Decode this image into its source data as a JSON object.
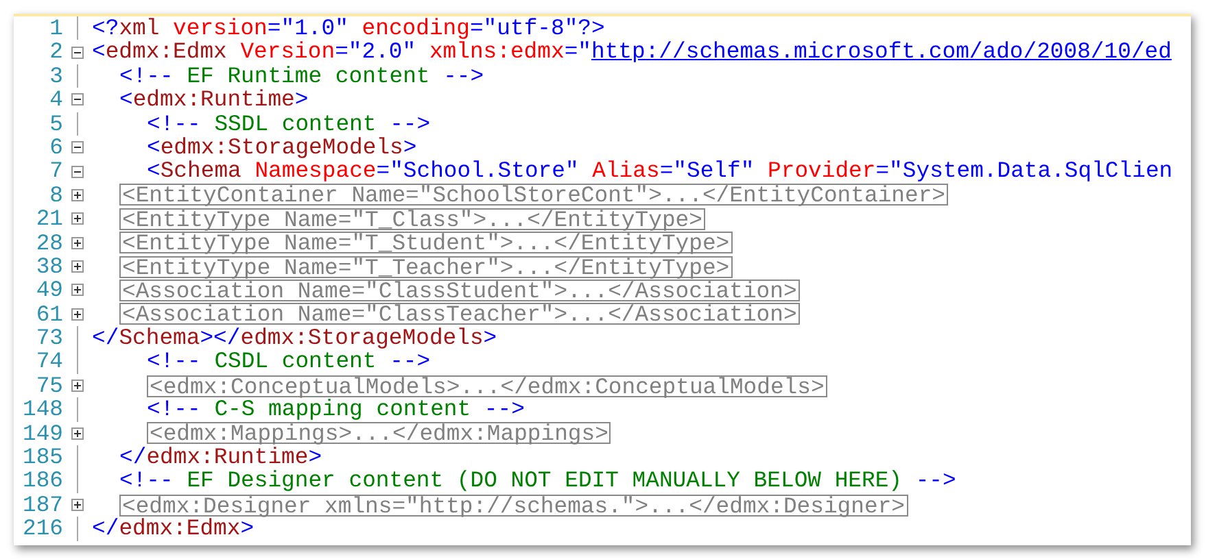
{
  "editor": {
    "lines": [
      {
        "number": "1",
        "kind": "root",
        "segments": [
          {
            "kind": "code",
            "tokens": [
              {
                "kind": "delim",
                "text": "<?"
              },
              {
                "kind": "tag",
                "text": "xml"
              },
              {
                "kind": "attr",
                "text": " version"
              },
              {
                "kind": "value",
                "text": "=\"1.0\""
              },
              {
                "kind": "attr",
                "text": " encoding"
              },
              {
                "kind": "value",
                "text": "=\"utf-8\""
              },
              {
                "kind": "delim",
                "text": "?>"
              }
            ]
          }
        ]
      },
      {
        "number": "2",
        "kind": "root",
        "expanded": true,
        "segments": [
          {
            "kind": "code",
            "tokens": [
              {
                "kind": "delim",
                "text": "<"
              },
              {
                "kind": "tag",
                "text": "edmx:Edmx"
              },
              {
                "kind": "attr",
                "text": " Version"
              },
              {
                "kind": "value",
                "text": "=\"2.0\""
              },
              {
                "kind": "attr",
                "text": " xmlns:edmx"
              },
              {
                "kind": "value",
                "text": "=\""
              }
            ]
          },
          {
            "kind": "link",
            "text": "http://schemas.microsoft.com/ado/2008/10/ed"
          }
        ]
      },
      {
        "number": "3",
        "kind": "child",
        "segments": [
          {
            "kind": "code",
            "tokens": [
              {
                "kind": "delim",
                "text": "<!--"
              },
              {
                "kind": "comment",
                "text": " EF Runtime content "
              },
              {
                "kind": "delim",
                "text": "-->"
              }
            ]
          }
        ]
      },
      {
        "number": "4",
        "kind": "child",
        "expanded": true,
        "segments": [
          {
            "kind": "code",
            "tokens": [
              {
                "kind": "delim",
                "text": "<"
              },
              {
                "kind": "tag",
                "text": "edmx:Runtime"
              },
              {
                "kind": "delim",
                "text": ">"
              }
            ]
          }
        ]
      },
      {
        "number": "5",
        "kind": "grandchild",
        "segments": [
          {
            "kind": "code",
            "tokens": [
              {
                "kind": "delim",
                "text": "<!--"
              },
              {
                "kind": "comment",
                "text": " SSDL content "
              },
              {
                "kind": "delim",
                "text": "-->"
              }
            ]
          }
        ]
      },
      {
        "number": "6",
        "kind": "grandchild",
        "expanded": true,
        "segments": [
          {
            "kind": "code",
            "tokens": [
              {
                "kind": "delim",
                "text": "<"
              },
              {
                "kind": "tag",
                "text": "edmx:StorageModels"
              },
              {
                "kind": "delim",
                "text": ">"
              }
            ]
          }
        ]
      },
      {
        "number": "7",
        "kind": "grandchild",
        "expanded": true,
        "segments": [
          {
            "kind": "code",
            "tokens": [
              {
                "kind": "delim",
                "text": "<"
              },
              {
                "kind": "tag",
                "text": "Schema"
              },
              {
                "kind": "attr",
                "text": " Namespace"
              },
              {
                "kind": "value",
                "text": "=\"School.Store\""
              },
              {
                "kind": "attr",
                "text": " Alias"
              },
              {
                "kind": "value",
                "text": "=\"Self\""
              },
              {
                "kind": "attr",
                "text": " Provider"
              },
              {
                "kind": "value",
                "text": "=\"System.Data.SqlClien"
              }
            ]
          }
        ]
      },
      {
        "number": "8",
        "kind": "child",
        "expanded": false,
        "segments": [
          {
            "kind": "collapsed",
            "text": "<EntityContainer Name=\"SchoolStoreCont\">...</EntityContainer>"
          }
        ]
      },
      {
        "number": "21",
        "kind": "child",
        "expanded": false,
        "segments": [
          {
            "kind": "collapsed",
            "text": "<EntityType Name=\"T_Class\">...</EntityType>"
          }
        ]
      },
      {
        "number": "28",
        "kind": "child",
        "expanded": false,
        "segments": [
          {
            "kind": "collapsed",
            "text": "<EntityType Name=\"T_Student\">...</EntityType>"
          }
        ]
      },
      {
        "number": "38",
        "kind": "child",
        "expanded": false,
        "segments": [
          {
            "kind": "collapsed",
            "text": "<EntityType Name=\"T_Teacher\">...</EntityType>"
          }
        ]
      },
      {
        "number": "49",
        "kind": "child",
        "expanded": false,
        "segments": [
          {
            "kind": "collapsed",
            "text": "<Association Name=\"ClassStudent\">...</Association>"
          }
        ]
      },
      {
        "number": "61",
        "kind": "child",
        "expanded": false,
        "segments": [
          {
            "kind": "collapsed",
            "text": "<Association Name=\"ClassTeacher\">...</Association>"
          }
        ]
      },
      {
        "number": "73",
        "kind": "root",
        "segments": [
          {
            "kind": "code",
            "tokens": [
              {
                "kind": "delim",
                "text": "</"
              },
              {
                "kind": "tag",
                "text": "Schema"
              },
              {
                "kind": "delim",
                "text": "></"
              },
              {
                "kind": "tag",
                "text": "edmx:StorageModels"
              },
              {
                "kind": "delim",
                "text": ">"
              }
            ]
          }
        ]
      },
      {
        "number": "74",
        "kind": "grandchild",
        "segments": [
          {
            "kind": "code",
            "tokens": [
              {
                "kind": "delim",
                "text": "<!--"
              },
              {
                "kind": "comment",
                "text": " CSDL content "
              },
              {
                "kind": "delim",
                "text": "-->"
              }
            ]
          }
        ]
      },
      {
        "number": "75",
        "kind": "grandchild",
        "expanded": false,
        "segments": [
          {
            "kind": "collapsed",
            "text": "<edmx:ConceptualModels>...</edmx:ConceptualModels>"
          }
        ]
      },
      {
        "number": "148",
        "kind": "grandchild",
        "segments": [
          {
            "kind": "code",
            "tokens": [
              {
                "kind": "delim",
                "text": "<!--"
              },
              {
                "kind": "comment",
                "text": " C-S mapping content "
              },
              {
                "kind": "delim",
                "text": "-->"
              }
            ]
          }
        ]
      },
      {
        "number": "149",
        "kind": "grandchild",
        "expanded": false,
        "segments": [
          {
            "kind": "collapsed",
            "text": "<edmx:Mappings>...</edmx:Mappings>"
          }
        ]
      },
      {
        "number": "185",
        "kind": "child",
        "segments": [
          {
            "kind": "code",
            "tokens": [
              {
                "kind": "delim",
                "text": "</"
              },
              {
                "kind": "tag",
                "text": "edmx:Runtime"
              },
              {
                "kind": "delim",
                "text": ">"
              }
            ]
          }
        ]
      },
      {
        "number": "186",
        "kind": "child",
        "segments": [
          {
            "kind": "code",
            "tokens": [
              {
                "kind": "delim",
                "text": "<!--"
              },
              {
                "kind": "comment",
                "text": " EF Designer content (DO NOT EDIT MANUALLY BELOW HERE) "
              },
              {
                "kind": "delim",
                "text": "-->"
              }
            ]
          }
        ]
      },
      {
        "number": "187",
        "kind": "child",
        "expanded": false,
        "segments": [
          {
            "kind": "collapsed",
            "text": "<edmx:Designer xmlns=\"http://schemas.\">...</edmx:Designer>"
          }
        ]
      },
      {
        "number": "216",
        "kind": "root",
        "segments": [
          {
            "kind": "code",
            "tokens": [
              {
                "kind": "delim",
                "text": "</"
              },
              {
                "kind": "tag",
                "text": "edmx:Edmx"
              },
              {
                "kind": "delim",
                "text": ">"
              }
            ]
          }
        ]
      }
    ]
  }
}
